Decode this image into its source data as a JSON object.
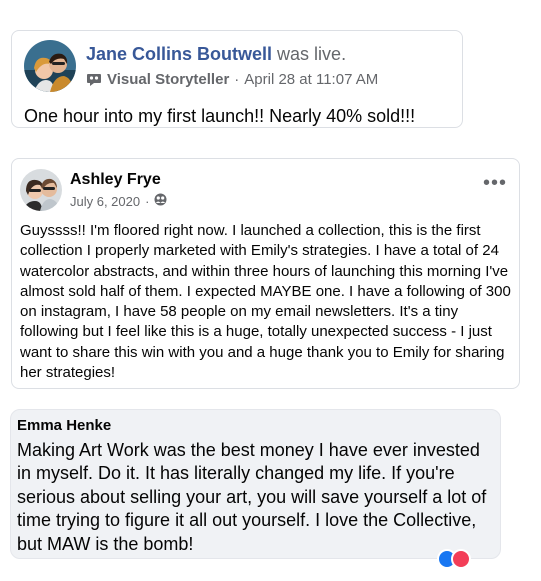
{
  "post1": {
    "author": "Jane Collins Boutwell",
    "status": "was live.",
    "badge_icon": "visual-storyteller-badge-icon",
    "badge": "Visual Storyteller",
    "separator": "·",
    "timestamp": "April 28 at 11:07 AM",
    "text": "One hour into my first launch!! Nearly 40% sold!!!"
  },
  "post2": {
    "author": "Ashley Frye",
    "date": "July 6, 2020",
    "separator": "·",
    "privacy_icon": "group-audience-icon",
    "menu_label": "•••",
    "text": "Guyssss!! I'm floored right now. I launched a collection, this is the first collection I properly marketed with Emily's strategies. I have a total of 24 watercolor abstracts, and within three hours of launching this morning I've almost sold half of them. I expected MAYBE one. I have a following of 300 on instagram, I have 58 people on my email newsletters. It's a tiny following but I feel like this is a huge, totally unexpected success - I just want to share this win with you and a huge thank you to Emily for sharing her strategies!"
  },
  "comment": {
    "author": "Emma Henke",
    "text": "Making Art Work was the best money I have ever invested in myself. Do it. It has literally changed my life. If you're serious about selling your art, you will save yourself a lot of time trying to figure it all out yourself. I love the Collective, but MAW is the bomb!",
    "reactions": [
      "like-reaction-icon",
      "love-reaction-icon"
    ]
  },
  "colors": {
    "link_blue": "#385898",
    "secondary_text": "#65676b",
    "comment_bg": "#f0f2f5",
    "like": "#1877f2",
    "love": "#f33e58"
  }
}
